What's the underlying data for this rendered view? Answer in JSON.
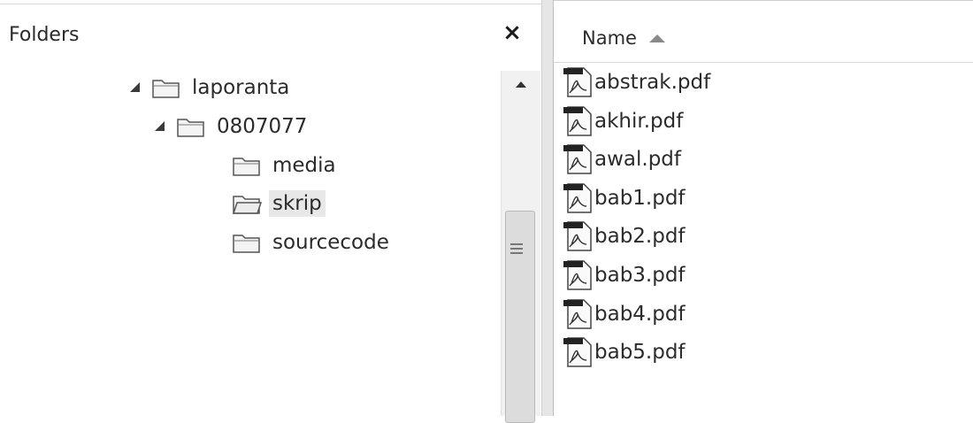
{
  "folders_pane": {
    "title": "Folders",
    "close_glyph": "×",
    "tree": [
      {
        "label": "laporanta",
        "expanded": true,
        "level": 0,
        "selected": false,
        "icon": "folder-icon"
      },
      {
        "label": "0807077",
        "expanded": true,
        "level": 1,
        "selected": false,
        "icon": "folder-icon"
      },
      {
        "label": "media",
        "expanded": false,
        "level": 2,
        "selected": false,
        "icon": "folder-icon"
      },
      {
        "label": "skrip",
        "expanded": false,
        "level": 2,
        "selected": true,
        "icon": "folder-icon"
      },
      {
        "label": "sourcecode",
        "expanded": false,
        "level": 2,
        "selected": false,
        "icon": "folder-icon"
      }
    ]
  },
  "file_list": {
    "column_name": "Name",
    "sort": "ascending",
    "files": [
      {
        "name": "abstrak.pdf",
        "icon": "pdf-file-icon"
      },
      {
        "name": "akhir.pdf",
        "icon": "pdf-file-icon"
      },
      {
        "name": "awal.pdf",
        "icon": "pdf-file-icon"
      },
      {
        "name": "bab1.pdf",
        "icon": "pdf-file-icon"
      },
      {
        "name": "bab2.pdf",
        "icon": "pdf-file-icon"
      },
      {
        "name": "bab3.pdf",
        "icon": "pdf-file-icon"
      },
      {
        "name": "bab4.pdf",
        "icon": "pdf-file-icon"
      },
      {
        "name": "bab5.pdf",
        "icon": "pdf-file-icon"
      }
    ]
  },
  "colors": {
    "selection": "#e8e8e8",
    "divider": "#e6e6e6",
    "scrollbar": "#f1f1f1"
  }
}
